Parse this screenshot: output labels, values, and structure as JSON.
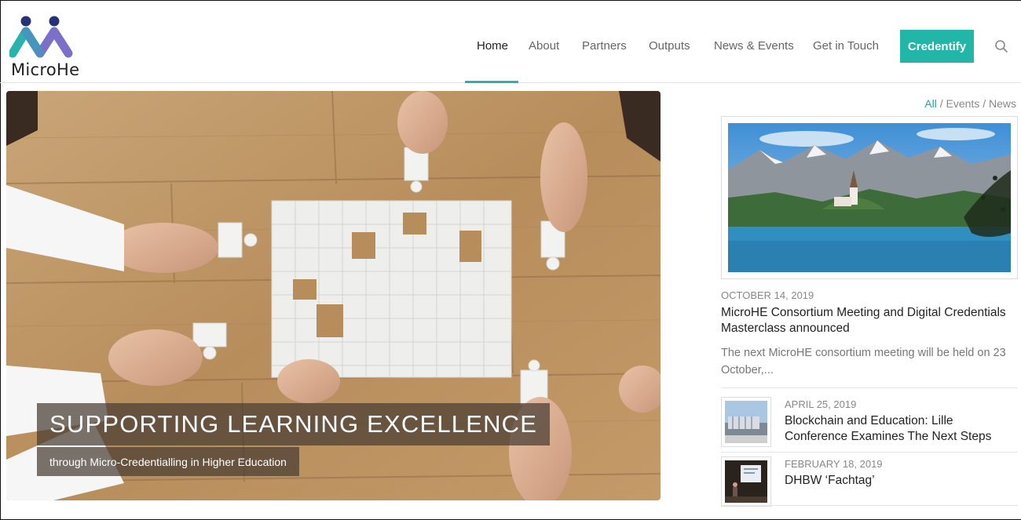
{
  "brand": {
    "name": "MicroHe",
    "colors": {
      "teal": "#2ab3ac",
      "purple": "#7b6fc9",
      "navy": "#27317a",
      "cta": "#21b6a8"
    }
  },
  "nav": {
    "items": [
      {
        "label": "Home",
        "active": true
      },
      {
        "label": "About"
      },
      {
        "label": "Partners"
      },
      {
        "label": "Outputs"
      },
      {
        "label": "News & Events"
      },
      {
        "label": "Get in Touch"
      }
    ],
    "cta_label": "Credentify",
    "search_icon": "search-icon"
  },
  "hero": {
    "title": "SUPPORTING LEARNING EXCELLENCE",
    "subtitle": "through Micro-Credentialling in Higher Education"
  },
  "sidebar": {
    "filters": {
      "all": "All",
      "sep": "/",
      "events": "Events",
      "news": "News"
    },
    "featured": {
      "date": "OCTOBER 14, 2019",
      "title": "MicroHE Consortium Meeting and Digital Credentials Masterclass announced",
      "excerpt": "The next MicroHE consortium meeting will be held on 23 October,..."
    },
    "items": [
      {
        "date": "APRIL 25, 2019",
        "title": "Blockchain and Education: Lille Conference Examines The Next Steps"
      },
      {
        "date": "FEBRUARY 18, 2019",
        "title": "DHBW ‘Fachtag’"
      }
    ]
  }
}
